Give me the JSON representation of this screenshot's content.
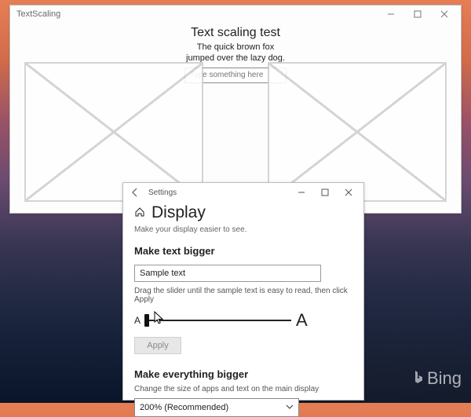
{
  "app_window": {
    "title": "TextScaling",
    "heading": "Text scaling test",
    "sample_line1": "The quick brown fox",
    "sample_line2": "jumped over the lazy dog.",
    "input_placeholder": "Type something here"
  },
  "settings_window": {
    "title": "Settings",
    "page_title": "Display",
    "subtitle": "Make your display easier to see.",
    "section1_heading": "Make text bigger",
    "sample_text_value": "Sample text",
    "slider_hint": "Drag the slider until the sample text is easy to read, then click Apply",
    "slider_small_label": "A",
    "slider_large_label": "A",
    "apply_label": "Apply",
    "section2_heading": "Make everything bigger",
    "section2_hint": "Change the size of apps and text on the main display",
    "dropdown_value": "200% (Recommended)"
  },
  "desktop": {
    "bing_label": "Bing"
  }
}
